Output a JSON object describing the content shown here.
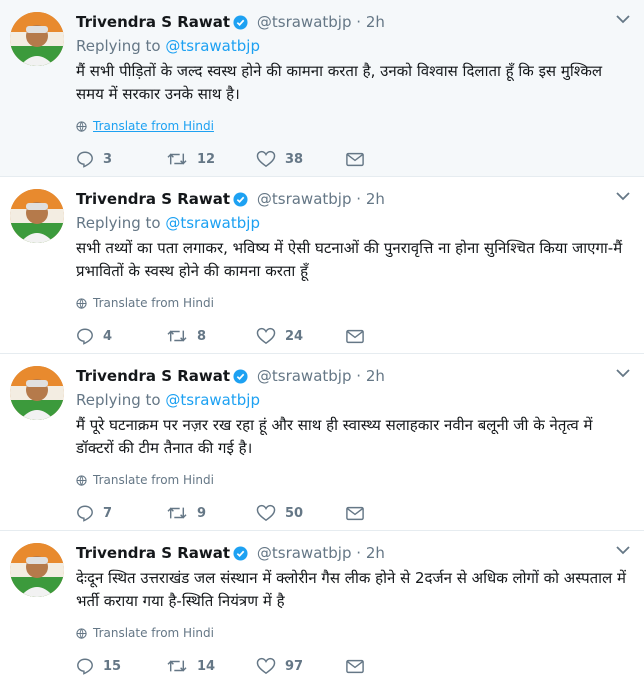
{
  "colors": {
    "accent": "#1da1f2",
    "muted": "#657786",
    "text": "#14171a",
    "highlight_bg": "#f5f8fa"
  },
  "translate_label": "Translate from Hindi",
  "tweets": [
    {
      "author": "Trivendra S Rawat",
      "handle": "@tsrawatbjp",
      "dot": "·",
      "time": "2h",
      "replying_prefix": "Replying to",
      "replying_to": "@tsrawatbjp",
      "text": "मैं सभी पीड़ितों के जल्द स्वस्थ होने की कामना करता है, उनको विश्वास दिलाता हूँ कि इस मुश्किल समय में सरकार उनके साथ है।",
      "replies": "3",
      "retweets": "12",
      "likes": "38"
    },
    {
      "author": "Trivendra S Rawat",
      "handle": "@tsrawatbjp",
      "dot": "·",
      "time": "2h",
      "replying_prefix": "Replying to",
      "replying_to": "@tsrawatbjp",
      "text": "सभी तथ्यों का पता लगाकर, भविष्य में ऐसी घटनाओं की पुनरावृत्ति ना होना सुनिश्चित किया जाएगा-मैं प्रभावितों के स्वस्थ होने की कामना करता हूँ",
      "replies": "4",
      "retweets": "8",
      "likes": "24"
    },
    {
      "author": "Trivendra S Rawat",
      "handle": "@tsrawatbjp",
      "dot": "·",
      "time": "2h",
      "replying_prefix": "Replying to",
      "replying_to": "@tsrawatbjp",
      "text": "मैं पूरे घटनाक्रम पर नज़र रख रहा हूं और साथ ही स्वास्थ्य सलाहकार नवीन बलूनी जी के नेतृत्व में डॉक्टरों की टीम तैनात की गई है।",
      "replies": "7",
      "retweets": "9",
      "likes": "50"
    },
    {
      "author": "Trivendra S Rawat",
      "handle": "@tsrawatbjp",
      "dot": "·",
      "time": "2h",
      "text": "देःदून स्थित उत्तराखंड जल संस्थान में क्लोरीन गैस लीक होने से 2दर्जन से अधिक लोगों को अस्पताल में भर्ती कराया गया है-स्थिति नियंत्रण में है",
      "replies": "15",
      "retweets": "14",
      "likes": "97"
    }
  ]
}
